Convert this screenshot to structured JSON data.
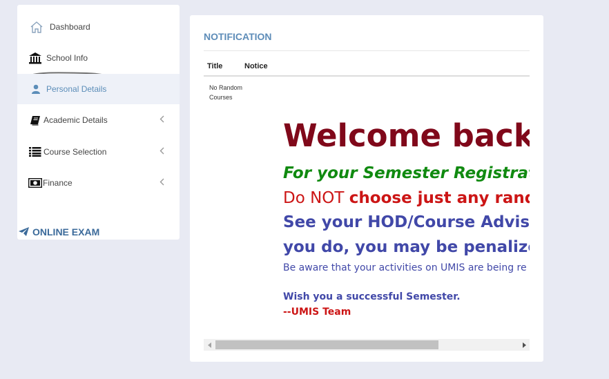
{
  "sidebar": {
    "items": [
      {
        "label": "Dashboard",
        "icon": "home-icon"
      },
      {
        "label": "School Info",
        "icon": "bank-icon"
      },
      {
        "label": "Personal Details",
        "icon": "user-icon",
        "active": true
      },
      {
        "label": "Academic Details",
        "icon": "book-icon",
        "has_submenu": true
      },
      {
        "label": "Course Selection",
        "icon": "list-icon",
        "has_submenu": true
      },
      {
        "label": "Finance",
        "icon": "money-icon",
        "has_submenu": true
      }
    ],
    "online_exam": {
      "label": "ONLINE EXAM",
      "icon": "paper-plane-icon"
    }
  },
  "notification": {
    "title": "NOTIFICATION",
    "columns": [
      "Title",
      "Notice"
    ],
    "row": {
      "title": "No Random Courses",
      "notice": {
        "welcome": "Welcome back!",
        "line1": "For your Semester Registrat",
        "line2_normal": "Do NOT ",
        "line2_bold": "choose just any rand",
        "line3": "See your HOD/Course Adviso",
        "line4": "you do, you may be penalize",
        "aware": "Be aware that your activities on UMIS are being re",
        "wish": "Wish you a successful Semester.",
        "team": "--UMIS Team"
      }
    }
  },
  "colors": {
    "accent": "#5d8cb8",
    "welcome": "#80081a",
    "green": "#108a10",
    "red": "#cc1515",
    "blue": "#4148a8"
  }
}
